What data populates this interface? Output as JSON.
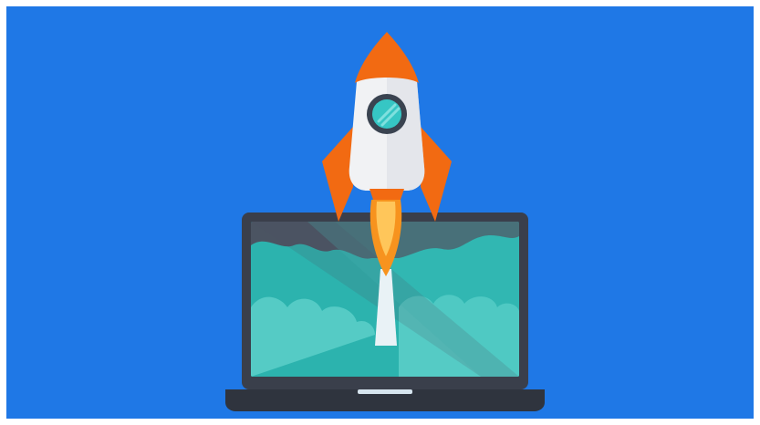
{
  "illustration": {
    "subject": "rocket-launching-from-laptop",
    "colors": {
      "background": "#1f78e6",
      "laptop_bezel": "#3a3f4b",
      "laptop_base": "#2f343e",
      "laptop_notch": "#d6e4ee",
      "screen_teal": "#19a6a4",
      "screen_dark": "#4b5462",
      "screen_light_teal": "#3fc3bf",
      "cloud_teal": "#2cb3ae",
      "cloud_light": "#55cbc5",
      "rocket_body": "#f1f2f4",
      "rocket_shade": "#d8dde3",
      "rocket_orange": "#f26a12",
      "window_ring": "#3a4350",
      "window_glass": "#36c6c4",
      "flame_outer": "#f7931e",
      "flame_inner": "#ffc65a",
      "smoke_trail": "#e9f2f6"
    }
  }
}
